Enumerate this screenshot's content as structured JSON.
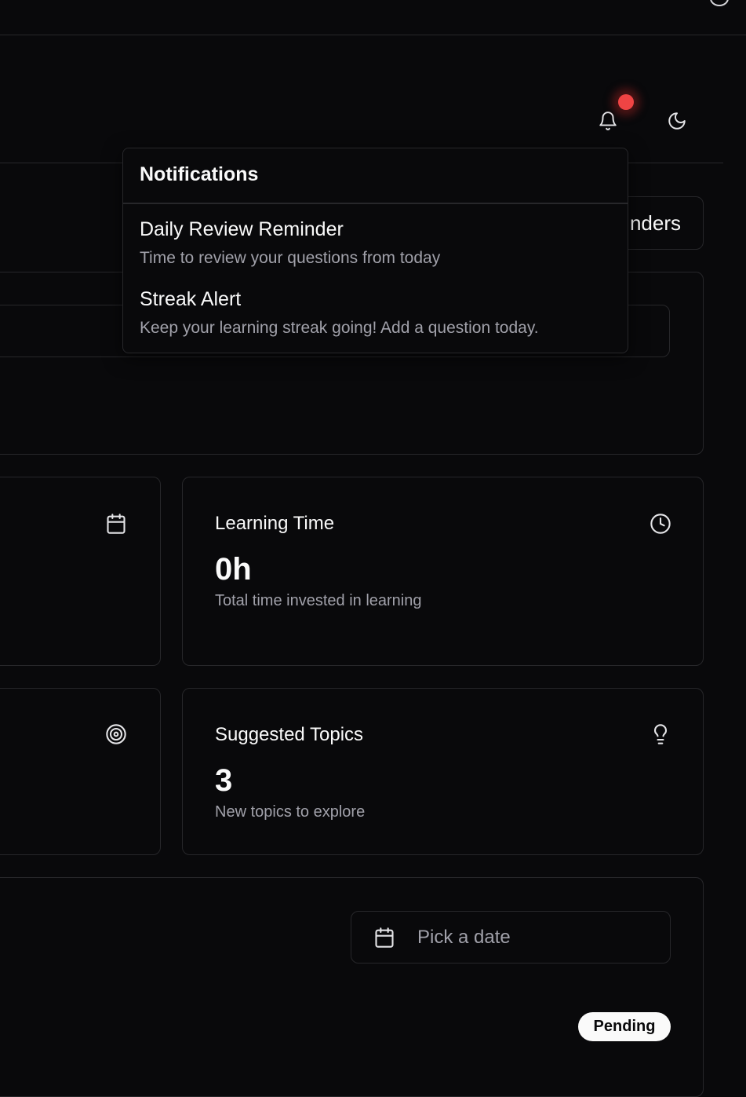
{
  "header": {
    "notification_icon": "bell-icon",
    "theme_icon": "moon-icon",
    "has_unread": true
  },
  "reminders_button": {
    "label": "nders"
  },
  "notifications": {
    "title": "Notifications",
    "items": [
      {
        "title": "Daily Review Reminder",
        "description": "Time to review your questions from today"
      },
      {
        "title": "Streak Alert",
        "description": "Keep your learning streak going! Add a question today."
      }
    ]
  },
  "cards": {
    "left_top": {
      "icon": "calendar-icon"
    },
    "left_bottom": {
      "icon": "target-icon"
    },
    "learning_time": {
      "title": "Learning Time",
      "value": "0h",
      "description": "Total time invested in learning",
      "icon": "clock-icon"
    },
    "suggested_topics": {
      "title": "Suggested Topics",
      "value": "3",
      "description": "New topics to explore",
      "icon": "lightbulb-icon"
    }
  },
  "date_picker": {
    "placeholder": "Pick a date",
    "icon": "calendar-icon"
  },
  "status_badge": {
    "label": "Pending"
  },
  "colors": {
    "background": "#09090b",
    "border": "#27272a",
    "muted_text": "#a1a1aa",
    "notification_dot": "#ef4444"
  }
}
